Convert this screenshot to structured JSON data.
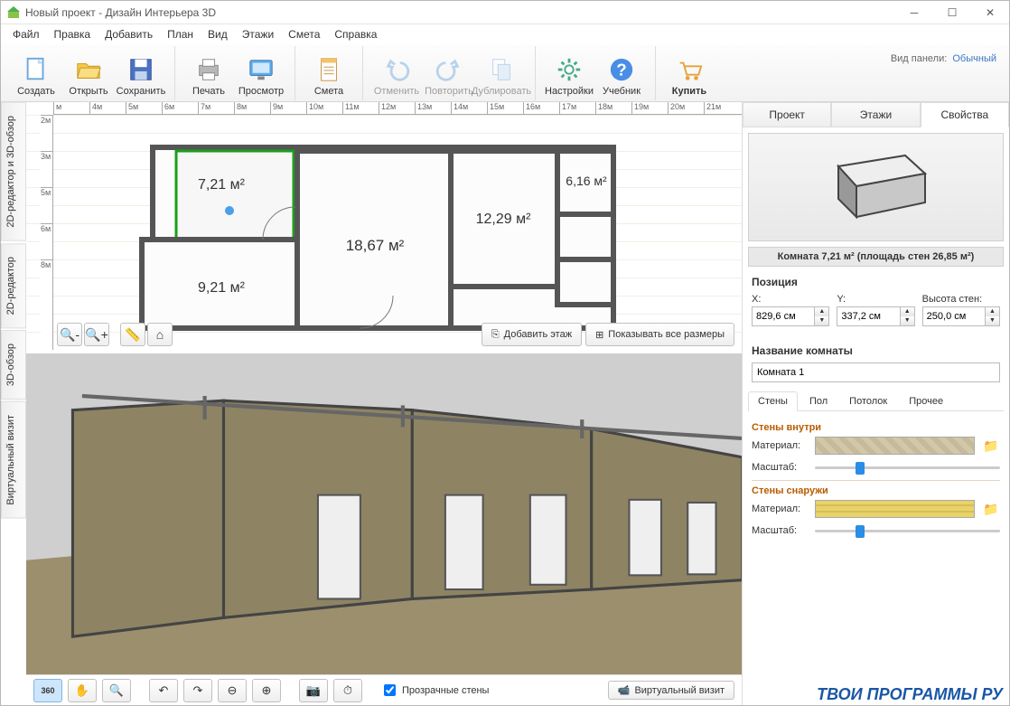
{
  "window": {
    "title": "Новый проект - Дизайн Интерьера 3D"
  },
  "menu": [
    "Файл",
    "Правка",
    "Добавить",
    "План",
    "Вид",
    "Этажи",
    "Смета",
    "Справка"
  ],
  "toolbar": {
    "create": "Создать",
    "open": "Открыть",
    "save": "Сохранить",
    "print": "Печать",
    "preview": "Просмотр",
    "estimate": "Смета",
    "undo": "Отменить",
    "redo": "Повторить",
    "dup": "Дублировать",
    "settings": "Настройки",
    "help": "Учебник",
    "buy": "Купить"
  },
  "panel_mode_label": "Вид панели:",
  "panel_mode_value": "Обычный",
  "sidetabs": [
    "2D-редактор и 3D-обзор",
    "2D-редактор",
    "3D-обзор",
    "Виртуальный визит"
  ],
  "ruler_h": [
    "м",
    "4м",
    "5м",
    "6м",
    "7м",
    "8м",
    "9м",
    "10м",
    "11м",
    "12м",
    "13м",
    "14м",
    "15м",
    "16м",
    "17м",
    "18м",
    "19м",
    "20м",
    "21м"
  ],
  "ruler_v": [
    "2м",
    "3м",
    "5м",
    "6м",
    "8м"
  ],
  "plan_rooms": {
    "r721": "7,21 м²",
    "r616": "6,16 м²",
    "r1229": "12,29 м²",
    "r1867": "18,67 м²",
    "r921": "9,21 м²"
  },
  "plan_btns": {
    "add_floor": "Добавить этаж",
    "show_dims": "Показывать все размеры"
  },
  "ptabs": [
    "Проект",
    "Этажи",
    "Свойства"
  ],
  "room_info": "Комната 7,21 м²  (площадь стен 26,85 м²)",
  "position": {
    "title": "Позиция",
    "x_label": "X:",
    "y_label": "Y:",
    "h_label": "Высота стен:",
    "x": "829,6 см",
    "y": "337,2 см",
    "h": "250,0 см"
  },
  "room_name": {
    "title": "Название комнаты",
    "value": "Комната 1"
  },
  "subtabs": [
    "Стены",
    "Пол",
    "Потолок",
    "Прочее"
  ],
  "walls": {
    "in_title": "Стены внутри",
    "out_title": "Стены снаружи",
    "material": "Материал:",
    "scale": "Масштаб:"
  },
  "footer": {
    "transparent": "Прозрачные стены",
    "virtual_visit": "Виртуальный визит"
  },
  "watermark": "ТВОИ ПРОГРАММЫ РУ"
}
